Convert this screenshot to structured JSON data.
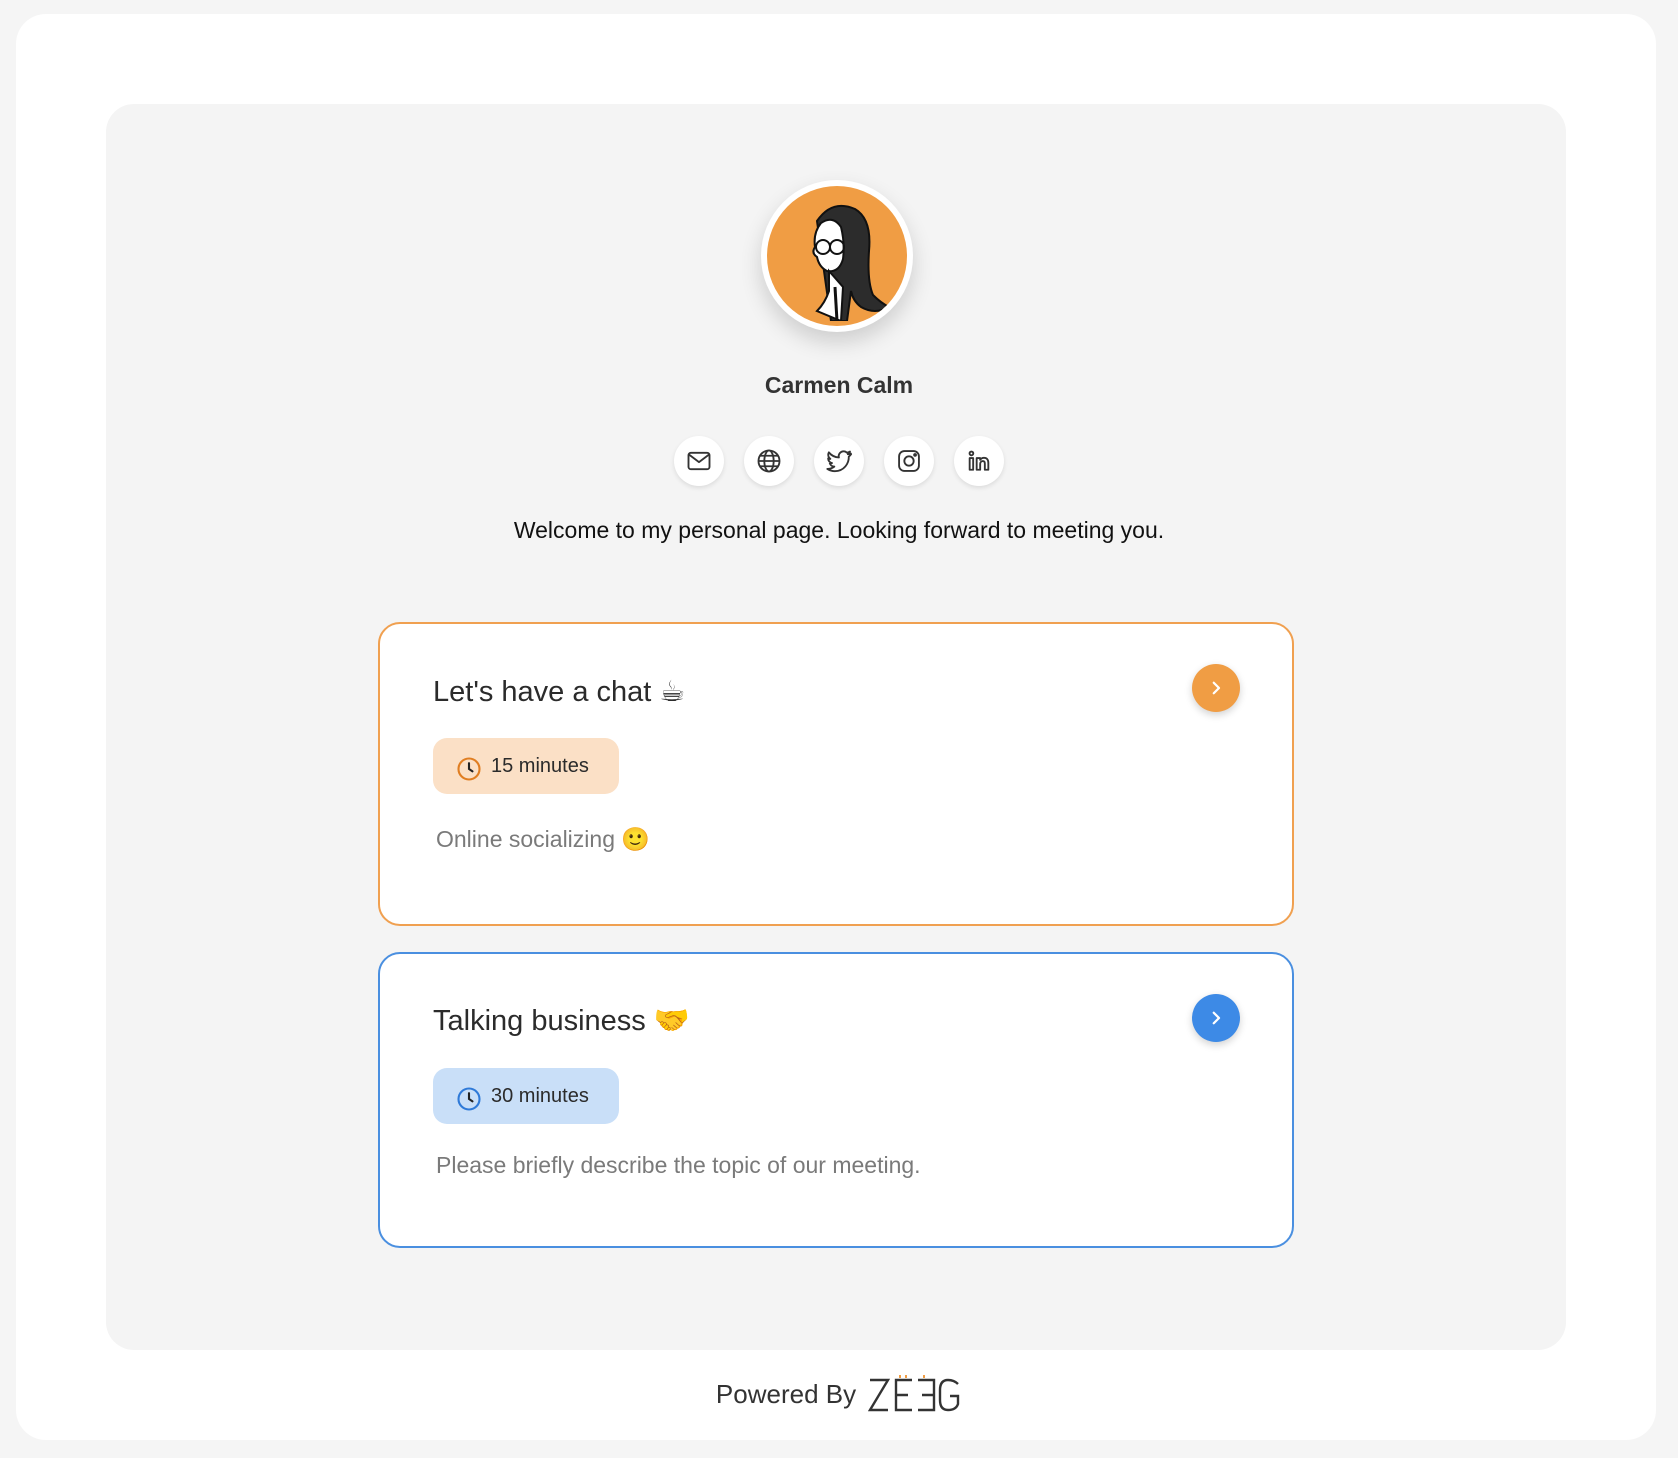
{
  "profile": {
    "name": "Carmen Calm",
    "welcome": "Welcome to my personal page. Looking forward to meeting you."
  },
  "socials": [
    {
      "icon": "mail-icon"
    },
    {
      "icon": "globe-icon"
    },
    {
      "icon": "twitter-icon"
    },
    {
      "icon": "instagram-icon"
    },
    {
      "icon": "linkedin-icon"
    }
  ],
  "events": [
    {
      "title": "Let's have a chat ☕",
      "duration": "15 minutes",
      "description": "Online socializing 🙂",
      "accent": "#f09d44"
    },
    {
      "title": "Talking business 🤝",
      "duration": "30 minutes",
      "description": "Please briefly describe the topic of our meeting.",
      "accent": "#3d8ae6"
    }
  ],
  "footer": {
    "powered_by": "Powered By",
    "logo_text": "ZEEG"
  }
}
